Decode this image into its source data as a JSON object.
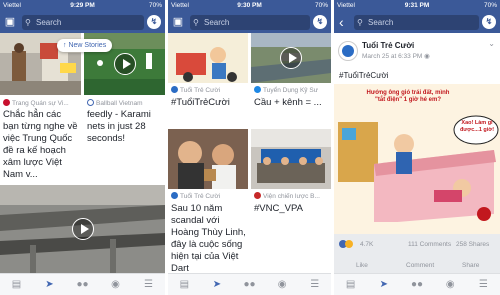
{
  "panels": [
    {
      "status": {
        "carrier": "Viettel",
        "time": "9:29 PM",
        "battery": "70%"
      },
      "search": {
        "placeholder": "Search"
      },
      "new_stories_label": "New Stories",
      "items": [
        {
          "source": "Trang Quán sự Vi...",
          "title": "Chắc hẳn các bạn từng nghe về việc Trung Quốc đề ra kế hoạch xâm lược Việt Nam v..."
        },
        {
          "source": "Ballball Vietnam",
          "title": "feedly - Karami nets in just 28 seconds!"
        }
      ]
    },
    {
      "status": {
        "carrier": "Viettel",
        "time": "9:30 PM",
        "battery": "70%"
      },
      "search": {
        "placeholder": "Search"
      },
      "items": [
        {
          "source": "Tuổi Trẻ Cười",
          "title": "#TuổiTrẻCười"
        },
        {
          "source": "Tuyển Dụng Kỹ Sư",
          "title": "Cầu + kênh = ..."
        },
        {
          "source": "Tuổi Trẻ Cười",
          "title": "Sau 10 năm scandal với Hoàng Thùy Linh, đây là cuộc sống hiện tại của Việt Dart"
        },
        {
          "source": "Viện chiến lược B...",
          "title": "#VNC_VPA"
        }
      ]
    },
    {
      "status": {
        "carrier": "Viettel",
        "time": "9:31 PM",
        "battery": "70%"
      },
      "search": {
        "placeholder": "Search"
      },
      "post": {
        "author": "Tuổi Trẻ Cười",
        "time": "March 25 at 6:33 PM",
        "text": "#TuổiTrẻCười",
        "comic_caption": "Hướng ông gió trái đất, mình \"tắt điện\" 1 giờ hé em?",
        "comic_bubble": "Xao! Làm gì được...1 giờ!",
        "reactions": "4.7K",
        "comments": "111 Comments",
        "shares": "258 Shares",
        "actions": {
          "like": "Like",
          "comment": "Comment",
          "share": "Share"
        }
      }
    }
  ],
  "colors": {
    "brand": "#3b5998",
    "link": "#4267b2",
    "muted": "#90949c",
    "text": "#1d2129"
  }
}
